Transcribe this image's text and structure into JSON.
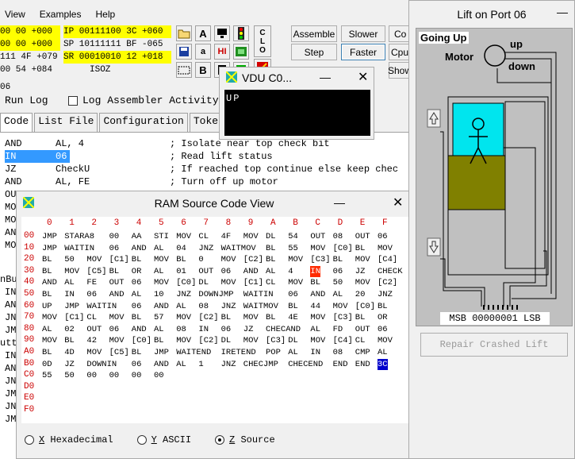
{
  "menu": [
    "View",
    "Examples",
    "Help"
  ],
  "registers": {
    "left": [
      {
        "t": "00 00 +000",
        "hl": true
      },
      {
        "t": "00 00 +000",
        "hl": true
      },
      {
        "t": "111 4F +079",
        "hl": false
      },
      {
        "t": "00 54 +084",
        "hl": false
      }
    ],
    "right": [
      {
        "t": "IP 00111100 3C +060",
        "hl": true
      },
      {
        "t": "SP 10111111 BF -065",
        "hl": false
      },
      {
        "t": "SR 00010010 12 +018",
        "hl": true
      },
      {
        "t": "     ISOZ",
        "hl": false
      }
    ],
    "field_06": "06",
    "run_log": "Run Log",
    "log_assembler": "Log Assembler Activity"
  },
  "toolbar": {
    "assemble": "Assemble",
    "slower": "Slower",
    "step": "Step",
    "faster": "Faster",
    "cpu": "Cpu",
    "show": "Show",
    "co": "Co",
    "clo": "CLO",
    "b": "B",
    "a_upper": "A",
    "a_lower": "a"
  },
  "tabs": [
    "Code",
    "List File",
    "Configuration",
    "Toke"
  ],
  "code_lines": [
    {
      "a": "AND",
      "b": "AL, 4",
      "c": "; Isolate near top check bit",
      "hl": false
    },
    {
      "a": "IN",
      "b": "06",
      "c": "; Read lift status",
      "hl": true
    },
    {
      "a": "JZ",
      "b": "CheckU",
      "c": "; If reached top continue else keep chec",
      "hl": false
    },
    {
      "a": "AND",
      "b": "AL, FE",
      "c": "; Turn off up motor",
      "hl": false
    },
    {
      "a": "OUT",
      "b": "06",
      "c": "",
      "hl": false
    }
  ],
  "code_fragments": [
    "MO",
    "MO",
    "AN",
    "MO"
  ],
  "left_fragments": [
    "nBu",
    "IN",
    "AN",
    "JN",
    "JM",
    "utt",
    "IN",
    "AN",
    "JN",
    "JM",
    "JN",
    "JM"
  ],
  "vdu": {
    "title": "VDU C0...",
    "text": "UP"
  },
  "ram": {
    "title": "RAM Source Code View",
    "cols": [
      "0",
      "1",
      "2",
      "3",
      "4",
      "5",
      "6",
      "7",
      "8",
      "9",
      "A",
      "B",
      "C",
      "D",
      "E",
      "F"
    ],
    "rows": [
      {
        "label": "00",
        "cells": [
          "JMP",
          "STARA8",
          "00",
          "AA",
          "STI",
          "MOV",
          "CL",
          "4F",
          "MOV",
          "DL",
          "54",
          "OUT",
          "08",
          "OUT",
          "06"
        ]
      },
      {
        "label": "10",
        "cells": [
          "JMP",
          "WAITIN",
          "06",
          "AND",
          "AL",
          "04",
          "JNZ",
          "WAITMOV",
          "BL",
          "55",
          "MOV",
          "[C0]",
          "BL",
          "MOV"
        ]
      },
      {
        "label": "20",
        "cells": [
          "BL",
          "50",
          "MOV",
          "[C1]",
          "BL",
          "MOV",
          "BL",
          "0",
          "MOV",
          "[C2]",
          "BL",
          "MOV",
          "[C3]",
          "BL",
          "MOV",
          "[C4]"
        ]
      },
      {
        "label": "30",
        "cells": [
          "BL",
          "MOV",
          "[C5]",
          "BL",
          "OR",
          "AL",
          "01",
          "OUT",
          "06",
          "AND",
          "AL",
          "4",
          "IN",
          "06",
          "JZ",
          "CHECK"
        ]
      },
      {
        "label": "40",
        "cells": [
          "AND",
          "AL",
          "FE",
          "OUT",
          "06",
          "MOV",
          "[C0]",
          "DL",
          "MOV",
          "[C1]",
          "CL",
          "MOV",
          "BL",
          "50",
          "MOV",
          "[C2]"
        ]
      },
      {
        "label": "50",
        "cells": [
          "BL",
          "IN",
          "06",
          "AND",
          "AL",
          "10",
          "JNZ",
          "DOWNJMP",
          "WAITIN",
          "06",
          "AND",
          "AL",
          "20",
          "JNZ"
        ]
      },
      {
        "label": "60",
        "cells": [
          "UP",
          "JMP",
          "WAITIN",
          "06",
          "AND",
          "AL",
          "08",
          "JNZ",
          "WAITMOV",
          "BL",
          "44",
          "MOV",
          "[C0]",
          "BL"
        ]
      },
      {
        "label": "70",
        "cells": [
          "MOV",
          "[C1]",
          "CL",
          "MOV",
          "BL",
          "57",
          "MOV",
          "[C2]",
          "BL",
          "MOV",
          "BL",
          "4E",
          "MOV",
          "[C3]",
          "BL",
          "OR"
        ]
      },
      {
        "label": "80",
        "cells": [
          "AL",
          "02",
          "OUT",
          "06",
          "AND",
          "AL",
          "08",
          "IN",
          "06",
          "JZ",
          "CHECAND",
          "AL",
          "FD",
          "OUT",
          "06"
        ]
      },
      {
        "label": "90",
        "cells": [
          "MOV",
          "BL",
          "42",
          "MOV",
          "[C0]",
          "BL",
          "MOV",
          "[C2]",
          "DL",
          "MOV",
          "[C3]",
          "DL",
          "MOV",
          "[C4]",
          "CL",
          "MOV"
        ]
      },
      {
        "label": "A0",
        "cells": [
          "BL",
          "4D",
          "MOV",
          "[C5]",
          "BL",
          "JMP",
          "WAITEND",
          "IRETEND",
          "POP",
          "AL",
          "IN",
          "08",
          "CMP",
          "AL"
        ]
      },
      {
        "label": "B0",
        "cells": [
          "0D",
          "JZ",
          "DOWNIN",
          "06",
          "AND",
          "AL",
          "1",
          "JNZ",
          "CHECJMP",
          "CHECEND",
          "END",
          "END",
          "3C"
        ]
      },
      {
        "label": "C0",
        "cells": [
          "55",
          "50",
          "00",
          "00",
          "00",
          "00"
        ]
      },
      {
        "label": "D0",
        "cells": []
      },
      {
        "label": "E0",
        "cells": []
      },
      {
        "label": "F0",
        "cells": []
      }
    ],
    "radios": [
      {
        "key": "X",
        "label": "Hexadecimal",
        "on": false
      },
      {
        "key": "Y",
        "label": "ASCII",
        "on": false
      },
      {
        "key": "Z",
        "label": "Source",
        "on": true
      }
    ]
  },
  "lift": {
    "title": "Lift on Port 06",
    "status": "Going Up",
    "motor": "Motor",
    "up": "up",
    "down": "down",
    "msb_lsb": "MSB 00000001 LSB",
    "repair": "Repair Crashed Lift"
  }
}
